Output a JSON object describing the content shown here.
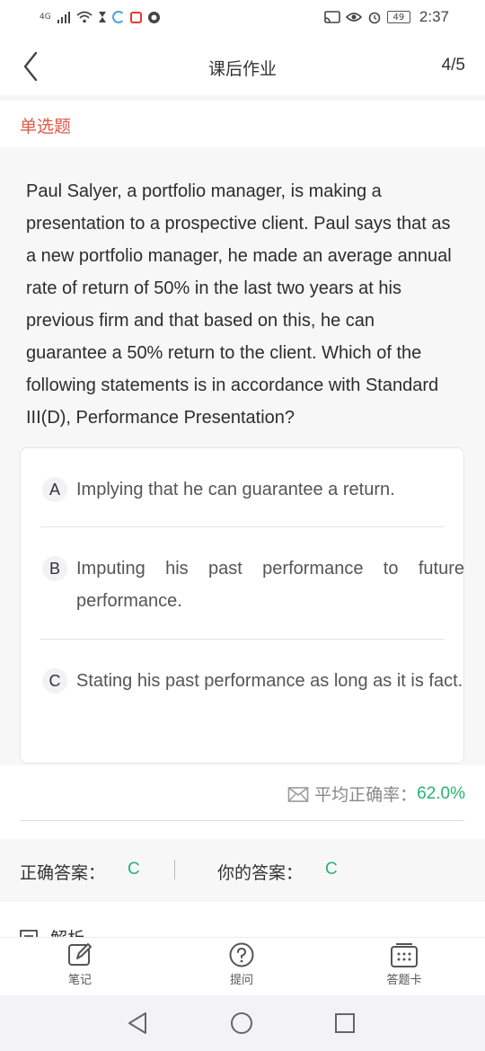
{
  "status_bar": {
    "network": "4G",
    "battery": "49",
    "time": "2:37"
  },
  "nav": {
    "title": "课后作业",
    "progress": "4/5"
  },
  "question": {
    "type_label": "单选题",
    "text": "Paul Salyer, a portfolio manager, is making a presentation to a prospective client. Paul says that as a new portfolio manager, he made an average annual rate of return of 50% in the last two years at his previous firm and that based on this, he can guarantee a 50% return to the client. Which of the following statements is in accordance with Standard III(D), Performance Presentation?",
    "options": [
      {
        "letter": "A",
        "text": "Implying that he can guarantee a return."
      },
      {
        "letter": "B",
        "text": "Imputing his past performance to future performance."
      },
      {
        "letter": "C",
        "text": "Stating his past performance as long as it is fact."
      }
    ]
  },
  "stats": {
    "avg_label": "平均正确率：",
    "avg_value": "62.0%"
  },
  "answers": {
    "correct_label": "正确答案：",
    "correct_value": "C",
    "yours_label": "你的答案：",
    "yours_value": "C"
  },
  "analysis": {
    "label": "解析"
  },
  "toolbar": {
    "notes": "笔记",
    "ask": "提问",
    "answer_card": "答题卡"
  },
  "colors": {
    "accent_green": "#29b36f",
    "type_red": "#e05a4a"
  }
}
